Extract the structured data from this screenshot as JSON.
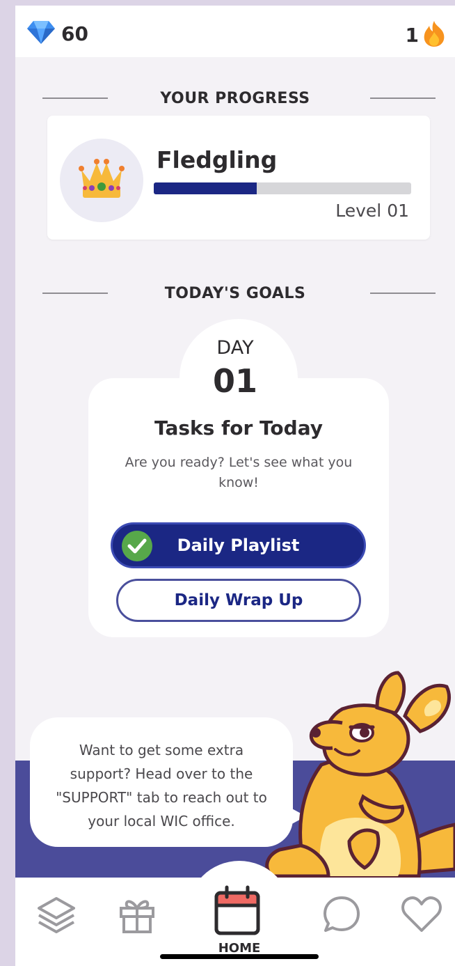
{
  "header": {
    "gems_count": "60",
    "streak_count": "1"
  },
  "progress": {
    "section_title": "YOUR PROGRESS",
    "rank": "Fledgling",
    "level_label": "Level 01",
    "progress_fraction": 0.4
  },
  "goals": {
    "section_title": "TODAY'S GOALS",
    "day_label": "DAY",
    "day_number": "01",
    "title": "Tasks for Today",
    "subtitle": "Are you ready? Let's see what you know!",
    "playlist_button": "Daily Playlist",
    "playlist_completed": true,
    "wrapup_button": "Daily Wrap Up"
  },
  "support": {
    "message": "Want to get some extra support? Head over to the \"SUPPORT\" tab to reach out to your local WIC office."
  },
  "nav": {
    "home_label": "HOME",
    "items": [
      "layers-icon",
      "gift-icon",
      "calendar-icon",
      "chat-icon",
      "heart-icon"
    ]
  },
  "colors": {
    "brand_navy": "#1b2784",
    "check_green": "#57a84a",
    "band_purple": "#4b4c9a",
    "kangaroo_orange": "#f7b93b",
    "calendar_red": "#f06a64"
  }
}
